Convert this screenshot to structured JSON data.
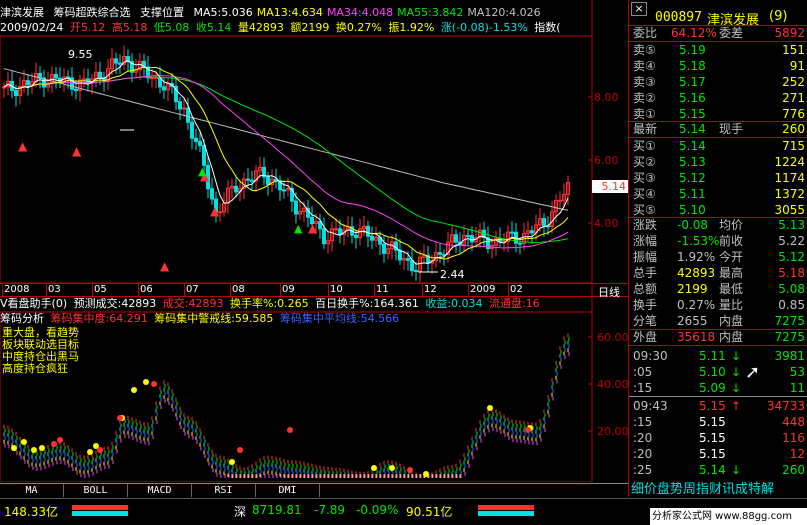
{
  "header": {
    "stock_name": "津滨发展",
    "indicator": "筹码超跌综合选",
    "sub": "支撑位置",
    "ma": [
      {
        "label": "MA5:5.036",
        "color": "#ffffff"
      },
      {
        "label": "MA13:4.634",
        "color": "#ffff00"
      },
      {
        "label": "MA34:4.048",
        "color": "#ff40ff"
      },
      {
        "label": "MA55:3.842",
        "color": "#00e600"
      },
      {
        "label": "MA120:4.026",
        "color": "#c0c0c0"
      }
    ],
    "close_icon": "×"
  },
  "info": {
    "date": "2009/02/24",
    "open": "开5.12",
    "high": "高5.18",
    "low": "低5.08",
    "close": "收5.14",
    "vol": "量42893",
    "amt": "额2199",
    "turn": "换0.27%",
    "amp": "振1.92%",
    "chg": "涨(-0.08)-1.53%",
    "idx": "指数("
  },
  "price_axis": [
    "8.00",
    "6.00",
    "4.00"
  ],
  "price_annot": {
    "high": "9.55",
    "low": "2.44",
    "current": "5.14"
  },
  "dates": [
    "2008",
    "03",
    "05",
    "06",
    "07",
    "08",
    "09",
    "10",
    "11",
    "12",
    "2009",
    "02"
  ],
  "period_label": "日线",
  "sub1": {
    "name": "V看盘助手(0)",
    "pred": "预测成交:42893",
    "vol": "成交:42893",
    "turn": "换手率%:0.265",
    "hundred": "百日换手%:164.361",
    "profit": "收益:0.034",
    "float": "流通盘:16"
  },
  "sub2": {
    "name": "筹码分析",
    "conc": "筹码集中度:64.291",
    "warn": "筹码集中警戒线:59.585",
    "mean": "筹码集中平均线:54.566"
  },
  "legend": [
    "重大盘，看趋势",
    "板块联动选目标",
    "中度持仓出黑马",
    "高度持仓疯狂"
  ],
  "sub2_axis": [
    "60.00",
    "40.00",
    "20.00"
  ],
  "tabs": [
    "MA",
    "BOLL",
    "MACD",
    "RSI",
    "DMI"
  ],
  "quote": {
    "code": "000897",
    "name": "津滨发展",
    "suffix": "(9)",
    "wb_label": "委比",
    "wb": "64.12%",
    "wc_label": "委差",
    "wc": "5892",
    "sells": [
      {
        "l": "卖⑤",
        "p": "5.19",
        "v": "151"
      },
      {
        "l": "卖④",
        "p": "5.18",
        "v": "91"
      },
      {
        "l": "卖③",
        "p": "5.17",
        "v": "252"
      },
      {
        "l": "卖②",
        "p": "5.16",
        "v": "271"
      },
      {
        "l": "卖①",
        "p": "5.15",
        "v": "776"
      }
    ],
    "last_label": "最新",
    "last": "5.14",
    "now_label": "现手",
    "now": "260",
    "buys": [
      {
        "l": "买①",
        "p": "5.14",
        "v": "715"
      },
      {
        "l": "买②",
        "p": "5.13",
        "v": "1224"
      },
      {
        "l": "买③",
        "p": "5.12",
        "v": "1174"
      },
      {
        "l": "买④",
        "p": "5.11",
        "v": "1372"
      },
      {
        "l": "买⑤",
        "p": "5.10",
        "v": "3055"
      }
    ],
    "stats": [
      {
        "a": "涨跌",
        "b": "-0.08",
        "c": "均价",
        "d": "5.13"
      },
      {
        "a": "涨幅",
        "b": "-1.53%",
        "c": "前收",
        "d": "5.22"
      },
      {
        "a": "振幅",
        "b": "1.92%",
        "c": "今开",
        "d": "5.12"
      },
      {
        "a": "总手",
        "b": "42893",
        "c": "最高",
        "d": "5.18"
      },
      {
        "a": "总额",
        "b": "2199",
        "c": "最低",
        "d": "5.08"
      },
      {
        "a": "换手",
        "b": "0.27%",
        "c": "量比",
        "d": "0.85"
      },
      {
        "a": "分笔",
        "b": "2655",
        "c": "内盘",
        "d": "7275"
      }
    ],
    "outer_label": "外盘",
    "outer": "35618",
    "inner_label": "内盘",
    "inner": "7275",
    "ticks": [
      {
        "t": "09:30",
        "p": "5.11",
        "d": "↓",
        "v": "3981"
      },
      {
        "t": ":05",
        "p": "5.10",
        "d": "↓",
        "v": "53"
      },
      {
        "t": ":15",
        "p": "5.09",
        "d": "↓",
        "v": "11"
      },
      {
        "t": "09:43",
        "p": "5.15",
        "d": "↑",
        "v": "34733"
      },
      {
        "t": ":15",
        "p": "5.15",
        "d": "",
        "v": "448"
      },
      {
        "t": ":20",
        "p": "5.15",
        "d": "",
        "v": "116"
      },
      {
        "t": ":20",
        "p": "5.15",
        "d": "",
        "v": "12"
      },
      {
        "t": ":25",
        "p": "5.14",
        "d": "↓",
        "v": "260"
      }
    ],
    "menu": "细价盘势周指财讯成特解"
  },
  "status": {
    "sh": "148.33亿",
    "sz_label": "深",
    "sz": "8719.81",
    "sz_chg": "-7.89",
    "sz_pct": "-0.09%",
    "sz_amt": "90.51亿"
  },
  "watermark": "分析家公式网 www.88gg.com",
  "colors": {
    "up": "#ff3232",
    "down": "#00e600",
    "ma5": "#ffffff",
    "ma13": "#ffff00",
    "ma34": "#ff40ff",
    "ma55": "#00e600",
    "ma120": "#c0c0c0"
  }
}
